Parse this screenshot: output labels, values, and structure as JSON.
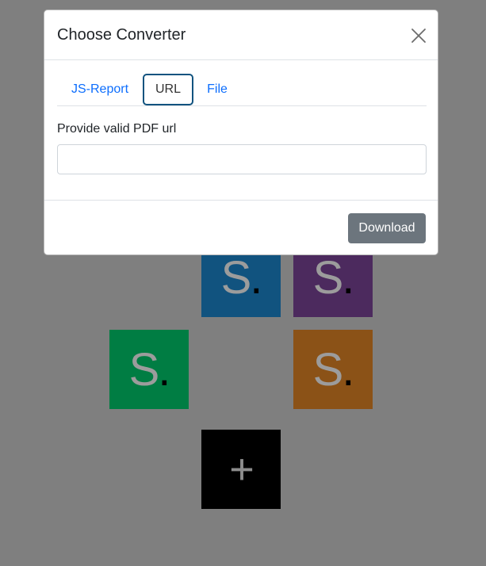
{
  "modal": {
    "title": "Choose Converter",
    "tabs": [
      {
        "label": "JS-Report",
        "active": false
      },
      {
        "label": "URL",
        "active": true
      },
      {
        "label": "File",
        "active": false
      }
    ],
    "url_label": "Provide valid PDF url",
    "url_value": "",
    "url_placeholder": "",
    "download_label": "Download"
  },
  "tiles": [
    {
      "letter": "S",
      "dot": ".",
      "color": "#11537f"
    },
    {
      "letter": "S",
      "dot": ".",
      "color": "#4c2a5e"
    },
    {
      "letter": "S",
      "dot": ".",
      "color": "#007d43"
    },
    {
      "letter": "S",
      "dot": ".",
      "color": "#8b5217"
    }
  ],
  "add_tile": {
    "symbol": "+"
  },
  "colors": {
    "overlay": "#7f7f7f",
    "primary_link": "#0d6efd",
    "secondary_button": "#6c757d"
  }
}
